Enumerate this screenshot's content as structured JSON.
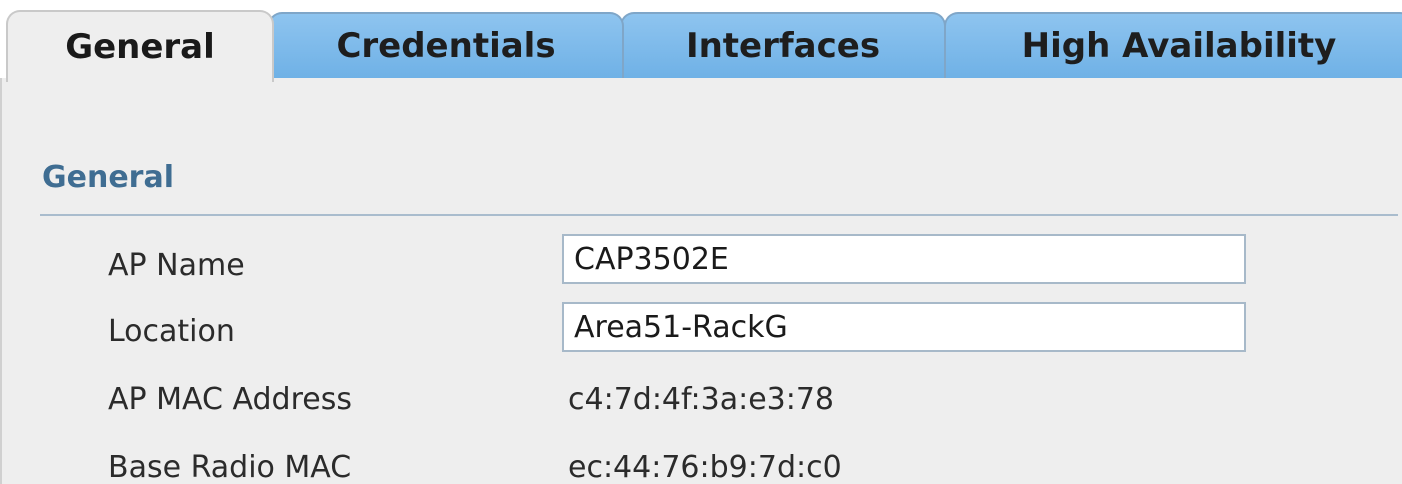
{
  "tabs": [
    {
      "label": "General",
      "active": true
    },
    {
      "label": "Credentials",
      "active": false
    },
    {
      "label": "Interfaces",
      "active": false
    },
    {
      "label": "High Availability",
      "active": false
    }
  ],
  "section": {
    "title": "General"
  },
  "fields": {
    "ap_name": {
      "label": "AP Name",
      "value": "CAP3502E"
    },
    "location": {
      "label": "Location",
      "value": "Area51-RackG"
    },
    "ap_mac": {
      "label": "AP MAC Address",
      "value": "c4:7d:4f:3a:e3:78"
    },
    "base_radio_mac": {
      "label": "Base Radio MAC",
      "value": "ec:44:76:b9:7d:c0"
    }
  },
  "colors": {
    "tab_inactive": "#7ab8ea",
    "tab_active": "#eeeeee",
    "section_title": "#3f6d92",
    "panel_background": "#eeeeee"
  }
}
